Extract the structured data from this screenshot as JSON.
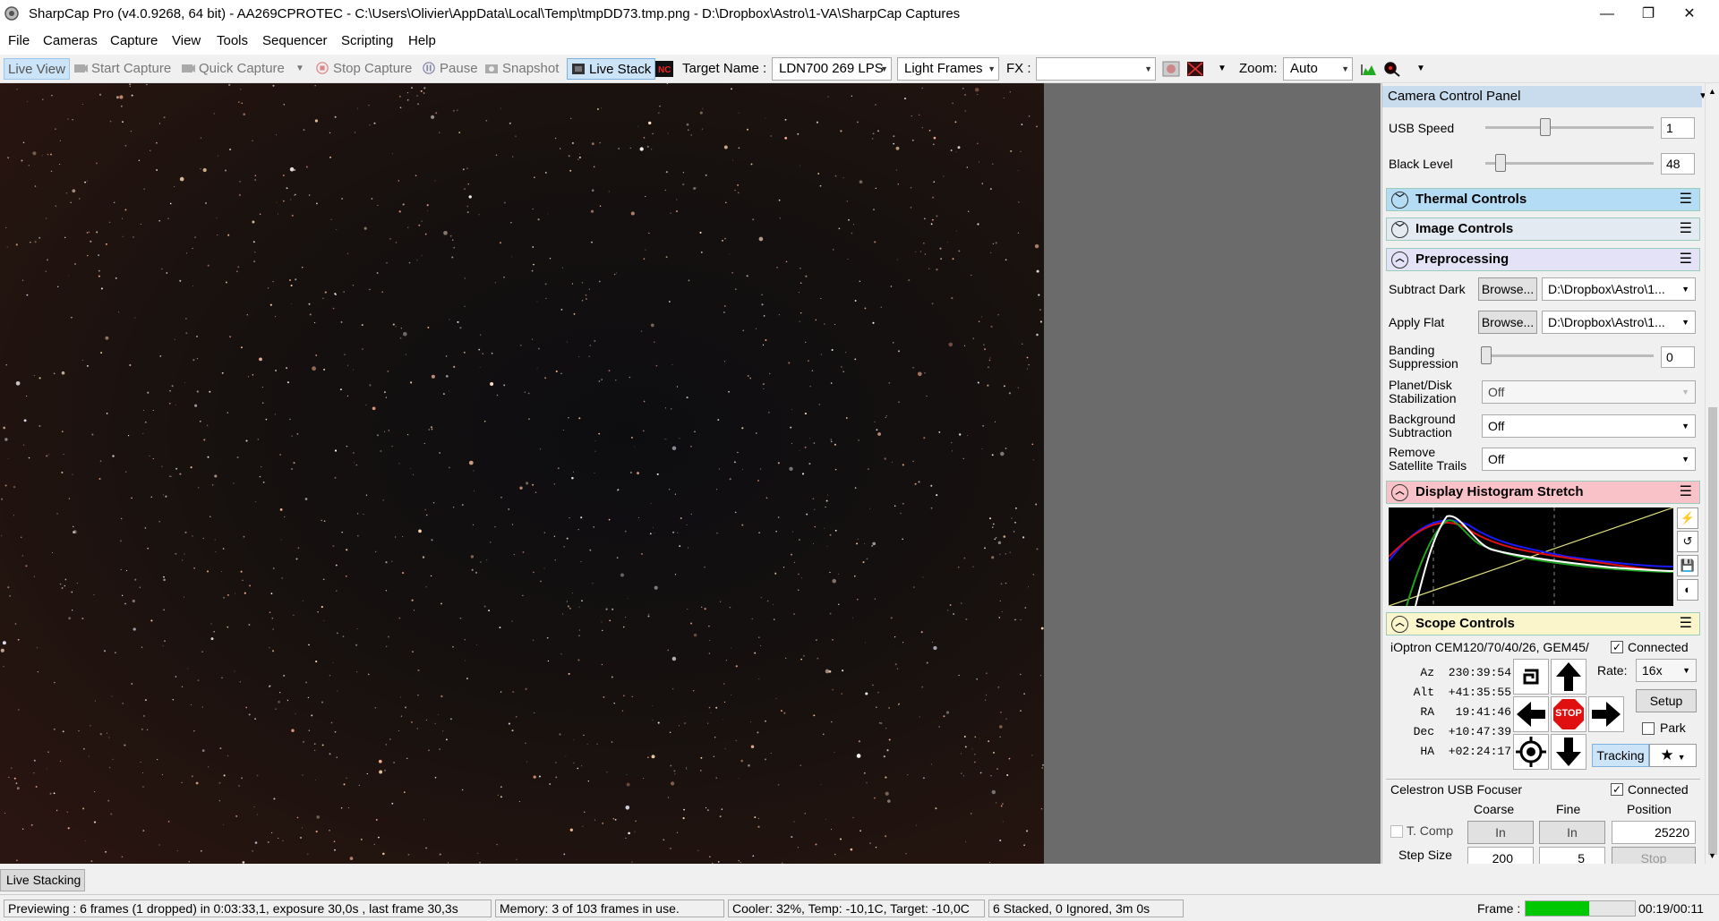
{
  "window": {
    "title": "SharpCap Pro (v4.0.9268, 64 bit) - AA269CPROTEC - C:\\Users\\Olivier\\AppData\\Local\\Temp\\tmpDD73.tmp.png - D:\\Dropbox\\Astro\\1-VA\\SharpCap Captures",
    "minimize": "—",
    "maximize": "❐",
    "close": "✕"
  },
  "menu": [
    "File",
    "Cameras",
    "Capture",
    "View",
    "Tools",
    "Sequencer",
    "Scripting",
    "Help"
  ],
  "toolbar": {
    "live_view": "Live View",
    "start_capture": "Start Capture",
    "quick_capture": "Quick Capture",
    "stop_capture": "Stop Capture",
    "pause": "Pause",
    "snapshot": "Snapshot",
    "live_stack": "Live Stack",
    "target_name_label": "Target Name :",
    "target_name_value": "LDN700 269 LPS",
    "frame_type": "Light Frames",
    "fx_label": "FX :",
    "fx_value": "",
    "zoom_label": "Zoom:",
    "zoom_value": "Auto"
  },
  "live_stacking_tab": "Live Stacking",
  "panel": {
    "title": "Camera Control Panel",
    "usb_speed_label": "USB Speed",
    "usb_speed_value": "1",
    "black_level_label": "Black Level",
    "black_level_value": "48",
    "groups": {
      "thermal": "Thermal Controls",
      "image": "Image Controls",
      "preprocessing": "Preprocessing",
      "histogram": "Display Histogram Stretch",
      "scope": "Scope Controls"
    },
    "subtract_dark_label": "Subtract Dark",
    "apply_flat_label": "Apply Flat",
    "browse_label": "Browse...",
    "dark_path": "D:\\Dropbox\\Astro\\1...",
    "flat_path": "D:\\Dropbox\\Astro\\1...",
    "banding_label_1": "Banding",
    "banding_label_2": "Suppression",
    "banding_value": "0",
    "stabilization_label_1": "Planet/Disk",
    "stabilization_label_2": "Stabilization",
    "stabilization_value": "Off",
    "background_label_1": "Background",
    "background_label_2": "Subtraction",
    "background_value": "Off",
    "satellite_label_1": "Remove",
    "satellite_label_2": "Satellite Trails",
    "satellite_value": "Off"
  },
  "scope": {
    "mount": "iOptron CEM120/70/40/26, GEM45/",
    "connected_label": "Connected",
    "coords": [
      {
        "k": "Az",
        "v": "230:39:54"
      },
      {
        "k": "Alt",
        "v": "+41:35:55"
      },
      {
        "k": "RA",
        "v": "19:41:46"
      },
      {
        "k": "Dec",
        "v": "+10:47:39"
      },
      {
        "k": "HA",
        "v": "+02:24:17"
      }
    ],
    "rate_label": "Rate:",
    "rate_value": "16x",
    "setup_label": "Setup",
    "park_label": "Park",
    "stop_label": "STOP",
    "tracking_label": "Tracking"
  },
  "focuser": {
    "name": "Celestron USB Focuser",
    "connected_label": "Connected",
    "coarse_label": "Coarse",
    "fine_label": "Fine",
    "position_label": "Position",
    "tcomp_label": "T. Comp",
    "in_label": "In",
    "position_value": "25220",
    "step_size_label": "Step Size",
    "coarse_step": "200",
    "fine_step": "5",
    "stop_label": "Stop"
  },
  "status": {
    "preview": "Previewing : 6 frames (1 dropped) in 0:03:33,1, exposure 30,0s , last frame 30,3s",
    "memory": "Memory: 3 of 103 frames in use.",
    "cooler": "Cooler: 32%, Temp: -10,1C, Target: -10,0C",
    "stacked": "6 Stacked, 0 Ignored, 3m 0s",
    "frame_label": "Frame :",
    "frame_progress": 0.58,
    "time": "00:19/00:11"
  },
  "colors": {
    "thermal_header": "#b5dcf5",
    "image_header": "#e4eaf2",
    "preprocessing_header": "#e3e2f7",
    "histogram_header": "#f9c2c8",
    "scope_header": "#fbf5cc",
    "progress": "#00c800",
    "stop_red": "#e01010"
  }
}
